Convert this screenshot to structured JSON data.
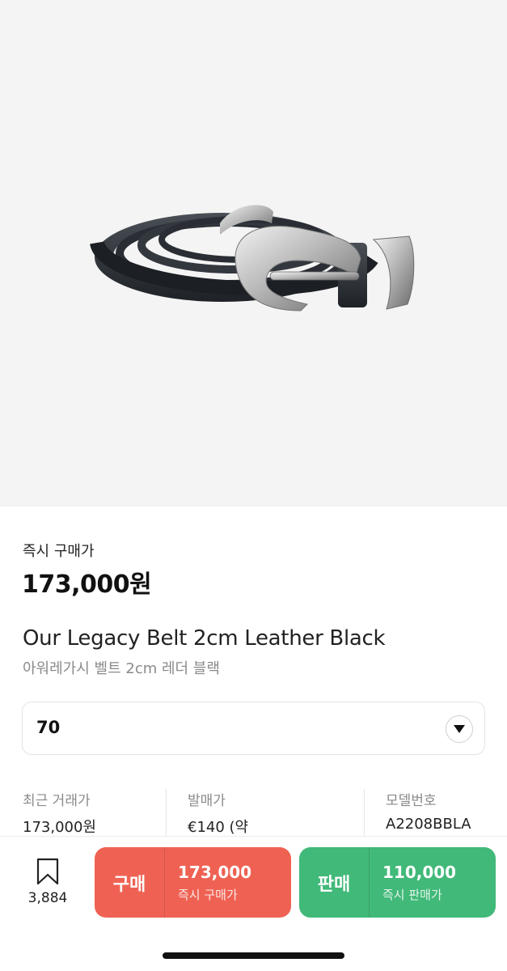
{
  "product": {
    "instant_buy_label": "즉시 구매가",
    "instant_buy_price": "173,000원",
    "name_en": "Our Legacy Belt 2cm Leather Black",
    "name_ko": "아워레가시 벨트 2cm 레더 블랙",
    "image_icon": "belt-product-image"
  },
  "size_select": {
    "selected": "70",
    "icon": "chevron-down-icon"
  },
  "info": {
    "recent": {
      "label": "최근 거래가",
      "value": "173,000원"
    },
    "release": {
      "label": "발매가",
      "value": "€140 (약"
    },
    "model": {
      "label": "모델번호",
      "value": "A2208BBLA"
    }
  },
  "bottom_bar": {
    "wish_icon": "bookmark-icon",
    "wish_count": "3,884",
    "buy": {
      "kind": "구매",
      "amount": "173,000",
      "sub": "즉시 구매가",
      "color": "#ef6253"
    },
    "sell": {
      "kind": "판매",
      "amount": "110,000",
      "sub": "즉시 판매가",
      "color": "#41b979"
    }
  }
}
